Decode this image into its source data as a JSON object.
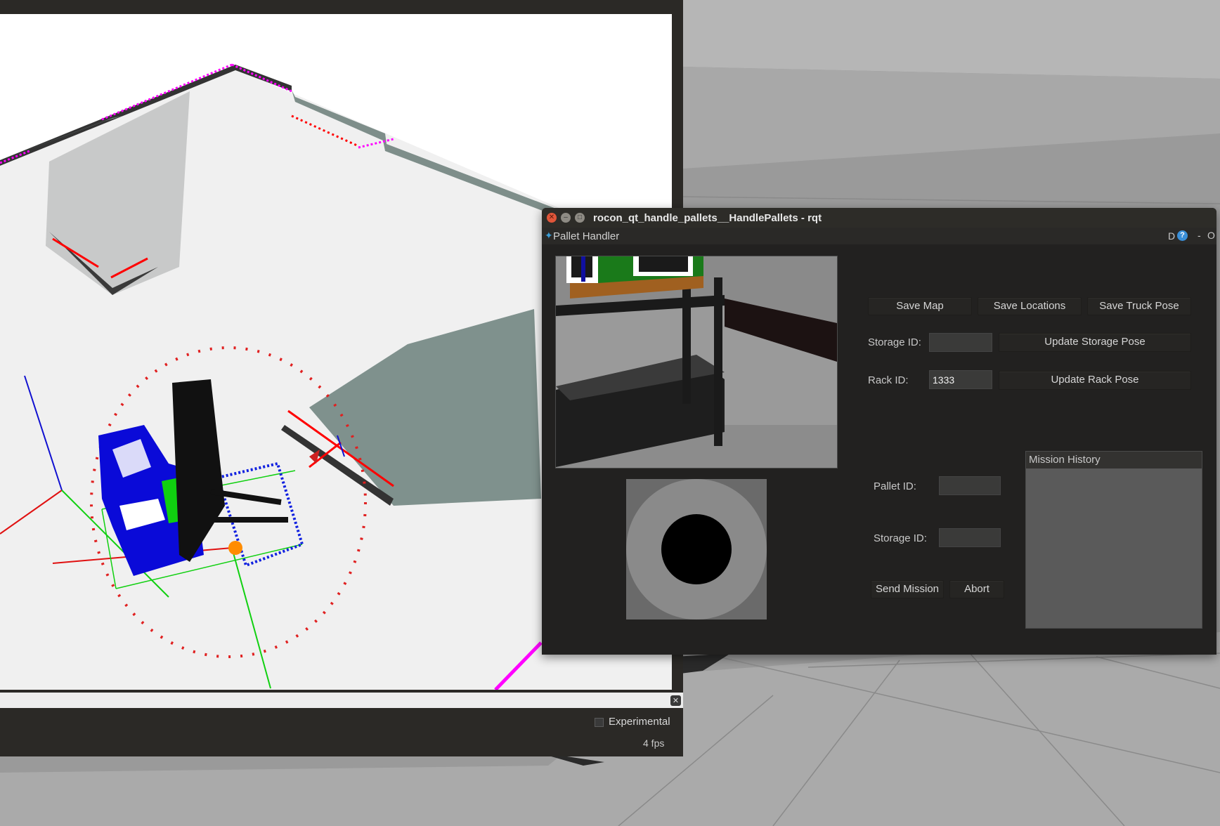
{
  "rviz": {
    "experimental_label": "Experimental",
    "fps_label": "4 fps",
    "close_glyph": "✕"
  },
  "rqt": {
    "window_title": "rocon_qt_handle_pallets__HandlePallets - rqt",
    "close_glyph": "✕",
    "min_glyph": "–",
    "max_glyph": "□",
    "plugin_icon": "rqt-plugin-icon",
    "plugin_title": "Pallet Handler",
    "plugin_d": "D",
    "help_glyph": "?",
    "plugin_dash": "-",
    "plugin_o": "O",
    "buttons": {
      "save_map": "Save Map",
      "save_locations": "Save Locations",
      "save_truck_pose": "Save Truck Pose",
      "update_storage_pose": "Update Storage Pose",
      "update_rack_pose": "Update Rack Pose",
      "send_mission": "Send Mission",
      "abort": "Abort"
    },
    "fields": {
      "storage_id_label": "Storage ID:",
      "storage_id_value": "",
      "rack_id_label": "Rack ID:",
      "rack_id_value": "1333",
      "pallet_id_label": "Pallet ID:",
      "pallet_id_value": "",
      "mission_storage_id_label": "Storage ID:",
      "mission_storage_id_value": ""
    },
    "mission_history_title": "Mission History"
  }
}
